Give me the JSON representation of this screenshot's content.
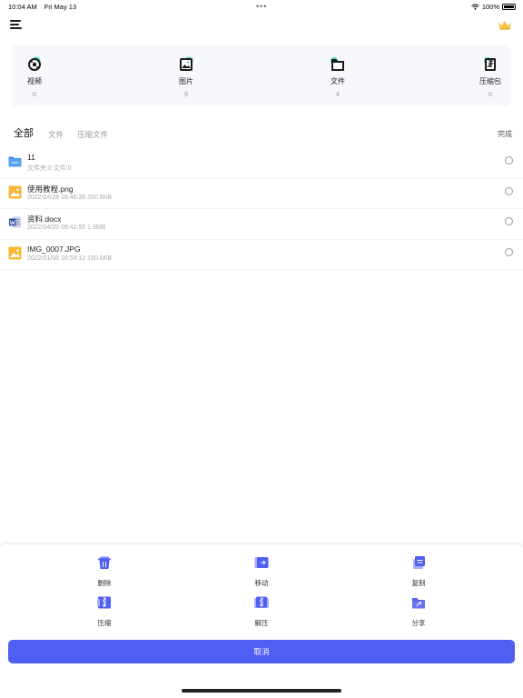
{
  "status_bar": {
    "time": "10:04 AM",
    "date": "Fri May 13",
    "dots": "•••",
    "battery": "100%"
  },
  "categories": [
    {
      "label": "视频",
      "count": "0",
      "icon": "video-icon"
    },
    {
      "label": "图片",
      "count": "9",
      "icon": "image-icon"
    },
    {
      "label": "文件",
      "count": "4",
      "icon": "folder-icon"
    },
    {
      "label": "压缩包",
      "count": "0",
      "icon": "zip-icon"
    }
  ],
  "tabs": [
    "全部",
    "文件",
    "压缩文件"
  ],
  "done_label": "完成",
  "files": [
    {
      "name": "11",
      "meta": "文件夹:0 文件:0",
      "icon": "folder-icon"
    },
    {
      "name": "使用教程.png",
      "meta": "2022/04/28 16:46:36 350.8KB",
      "icon": "image-file-icon"
    },
    {
      "name": "资料.docx",
      "meta": "2022/04/25 09:42:55 1.9MB",
      "icon": "word-file-icon"
    },
    {
      "name": "IMG_0007.JPG",
      "meta": "2022/01/08 16:54:12 160.6KB",
      "icon": "image-file-icon"
    }
  ],
  "actions": [
    {
      "label": "删除",
      "icon": "trash-icon"
    },
    {
      "label": "移动",
      "icon": "move-icon"
    },
    {
      "label": "复制",
      "icon": "copy-icon"
    },
    {
      "label": "压缩",
      "icon": "compress-icon"
    },
    {
      "label": "解压",
      "icon": "extract-icon"
    },
    {
      "label": "分享",
      "icon": "share-icon"
    }
  ],
  "cancel_label": "取消",
  "colors": {
    "accent": "#4f5ef3",
    "icon_bg": "#1a1a1a",
    "icon_accent": "#3fd6c8",
    "folder": "#4a90e8",
    "image_file": "#f7b733",
    "crown": "#f5c542"
  }
}
